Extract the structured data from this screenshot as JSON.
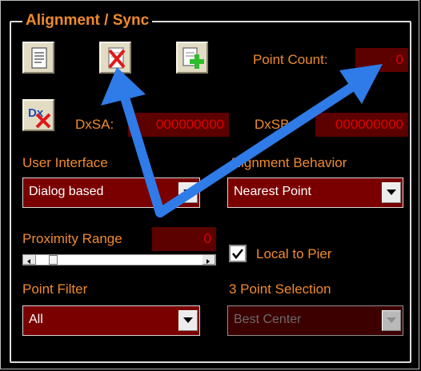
{
  "group": {
    "title": "Alignment / Sync"
  },
  "toolbar": {
    "icons": [
      "document-icon",
      "clear-icon",
      "add-point-icon",
      "dx-clear-icon"
    ]
  },
  "point_count": {
    "label": "Point Count:",
    "value": "0"
  },
  "dxsa": {
    "label": "DxSA:",
    "value": "000000000"
  },
  "dxsb": {
    "label": "DxSB:",
    "value": "000000000"
  },
  "user_interface": {
    "label": "User Interface",
    "selected": "Dialog based"
  },
  "alignment_behavior": {
    "label": "Alignment Behavior",
    "selected": "Nearest Point"
  },
  "proximity": {
    "label": "Proximity Range",
    "value": "0",
    "slider_position": 0.08
  },
  "local_to_pier": {
    "label": "Local to Pier",
    "checked": true
  },
  "point_filter": {
    "label": "Point Filter",
    "selected": "All"
  },
  "three_point": {
    "label": "3 Point Selection",
    "selected": "Best Center",
    "disabled": true
  },
  "colors": {
    "accent": "#f08a2c",
    "field_bg": "#7a0000",
    "numeric_text": "#e00000",
    "annotation_arrow": "#2f7be8"
  }
}
